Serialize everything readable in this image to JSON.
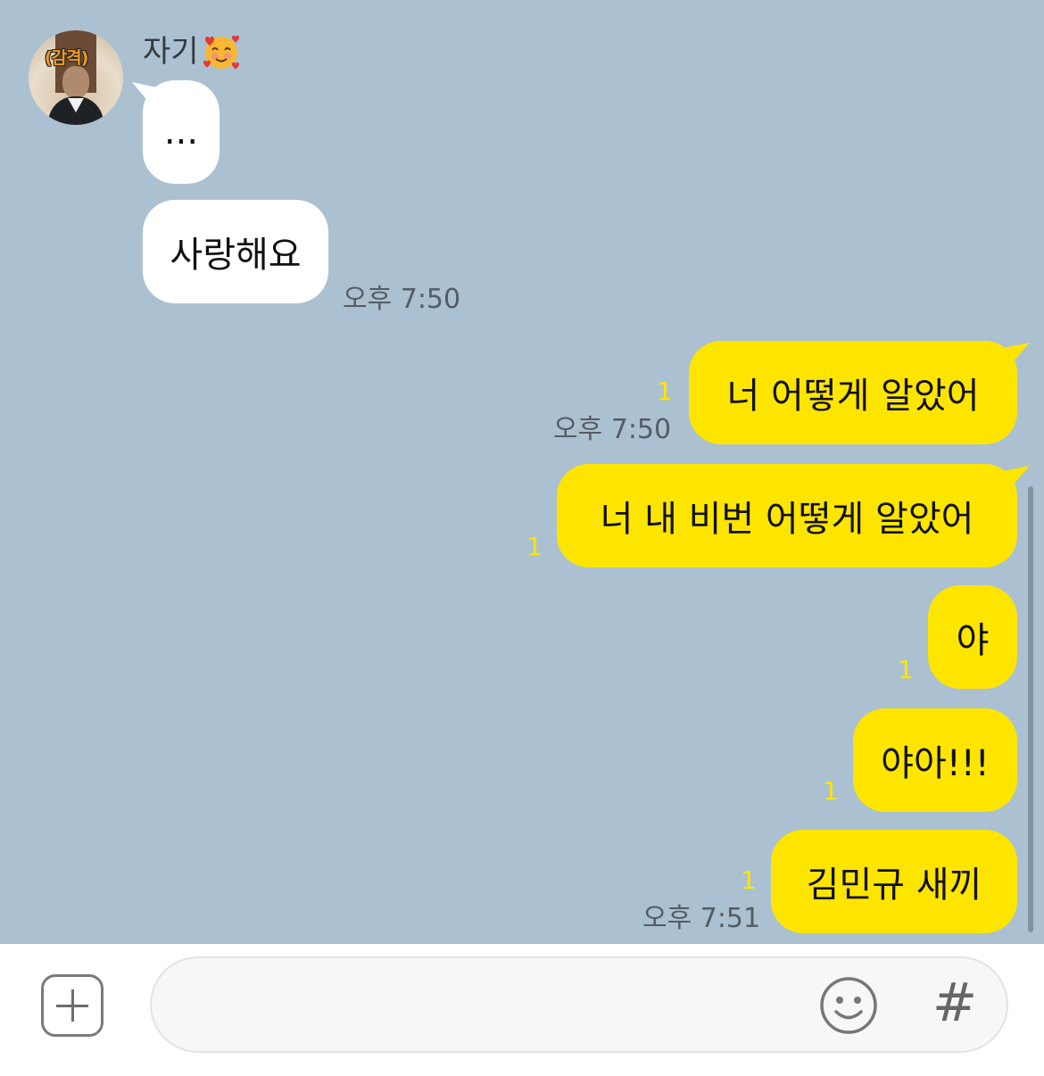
{
  "chat": {
    "sender_name": "자기",
    "avatar_caption": "(감격)",
    "incoming": [
      {
        "text": "..."
      },
      {
        "text": "사랑해요",
        "time": "오후 7:50"
      }
    ],
    "outgoing": [
      {
        "text": "너 어떻게 알았어",
        "unread": "1",
        "time": "오후 7:50"
      },
      {
        "text": "너 내 비번 어떻게 알았어",
        "unread": "1"
      },
      {
        "text": "야",
        "unread": "1"
      },
      {
        "text": "야아!!!",
        "unread": "1"
      },
      {
        "text": "김민규 새끼",
        "unread": "1",
        "time": "오후 7:51"
      }
    ]
  },
  "input_bar": {
    "placeholder": "",
    "hash_label": "#"
  },
  "icons": {
    "sender_emoji": "smiling-face-with-hearts-icon",
    "add": "plus-icon",
    "emoticon": "smiley-icon"
  },
  "colors": {
    "chat_background": "#abc1d1",
    "outgoing_bubble": "#fee500",
    "incoming_bubble": "#ffffff",
    "unread_count": "#fee500"
  }
}
